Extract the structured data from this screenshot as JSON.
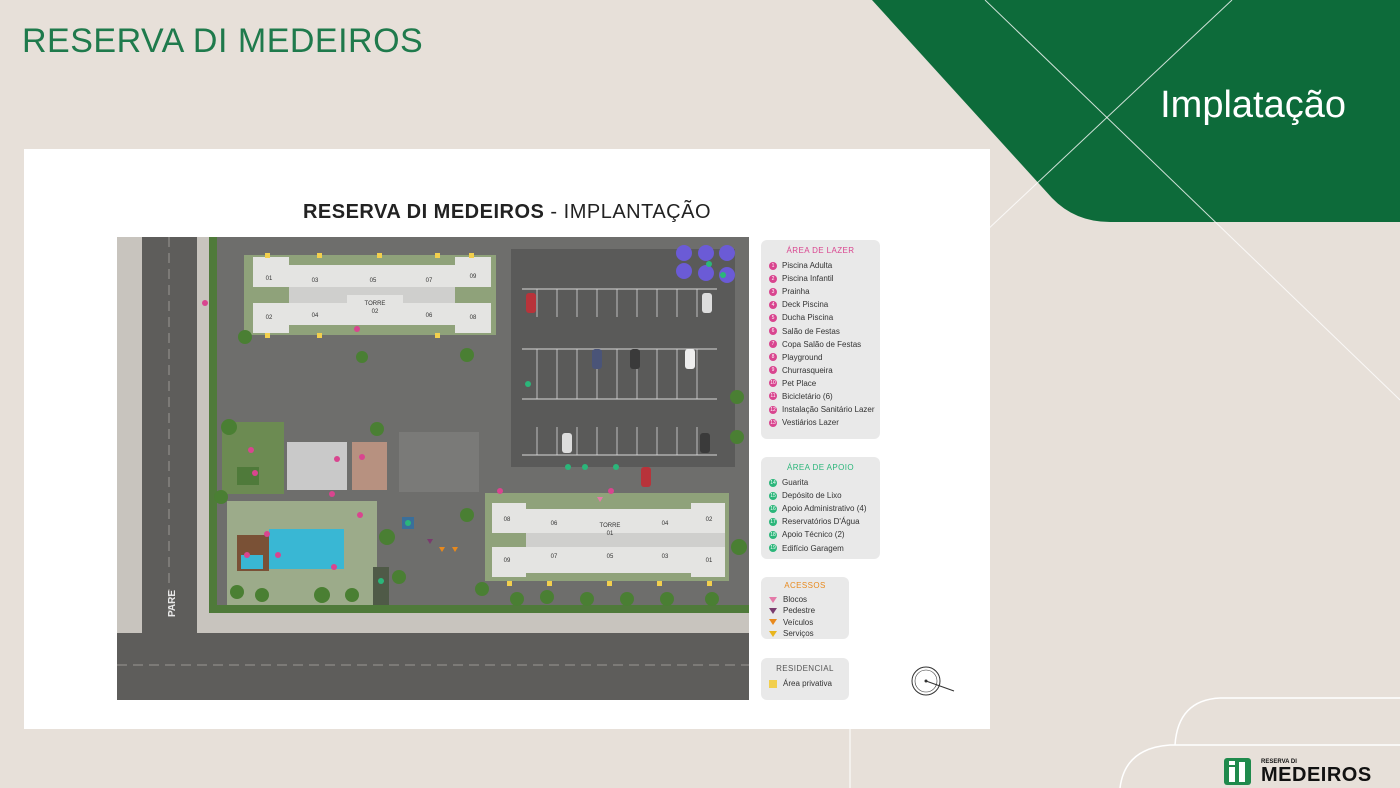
{
  "header": {
    "brand": "RESERVA DI MEDEIROS",
    "section": "Implatação"
  },
  "plan": {
    "title_bold": "RESERVA DI MEDEIROS",
    "title_rest": " - IMPLANTAÇÃO",
    "street_label": "PARE",
    "tower1": {
      "label": "TORRE",
      "number": "01",
      "units_top": [
        "08",
        "06",
        "04",
        "02"
      ],
      "units_bottom": [
        "09",
        "07",
        "05",
        "03",
        "01"
      ]
    },
    "tower2": {
      "label": "TORRE",
      "number": "02",
      "units_top": [
        "01",
        "03",
        "05",
        "07",
        "09"
      ],
      "units_bottom": [
        "02",
        "04",
        "06",
        "08"
      ]
    }
  },
  "legend": {
    "lazer": {
      "title": "ÁREA DE LAZER",
      "items": [
        {
          "n": "1",
          "label": "Piscina Adulta"
        },
        {
          "n": "2",
          "label": "Piscina Infantil"
        },
        {
          "n": "3",
          "label": "Prainha"
        },
        {
          "n": "4",
          "label": "Deck Piscina"
        },
        {
          "n": "5",
          "label": "Ducha Piscina"
        },
        {
          "n": "6",
          "label": "Salão de Festas"
        },
        {
          "n": "7",
          "label": "Copa Salão de Festas"
        },
        {
          "n": "8",
          "label": "Playground"
        },
        {
          "n": "9",
          "label": "Churrasqueira"
        },
        {
          "n": "10",
          "label": "Pet Place"
        },
        {
          "n": "11",
          "label": "Bicicletário (6)"
        },
        {
          "n": "12",
          "label": "Instalação Sanitário Lazer"
        },
        {
          "n": "13",
          "label": "Vestiários Lazer"
        }
      ]
    },
    "apoio": {
      "title": "ÁREA DE APOIO",
      "items": [
        {
          "n": "14",
          "label": "Guarita"
        },
        {
          "n": "15",
          "label": "Depósito de Lixo"
        },
        {
          "n": "16",
          "label": "Apoio Administrativo (4)"
        },
        {
          "n": "17",
          "label": "Reservatórios D'Água"
        },
        {
          "n": "18",
          "label": "Apoio Técnico (2)"
        },
        {
          "n": "19",
          "label": "Edifício Garagem"
        }
      ]
    },
    "acessos": {
      "title": "ACESSOS",
      "items": [
        {
          "label": "Blocos",
          "color": "#e47aa8"
        },
        {
          "label": "Pedestre",
          "color": "#7a3b6e"
        },
        {
          "label": "Veículos",
          "color": "#e8891d"
        },
        {
          "label": "Serviços",
          "color": "#e8b51d"
        }
      ]
    },
    "residencial": {
      "title": "RESIDENCIAL",
      "items": [
        {
          "label": "Área privativa"
        }
      ]
    }
  },
  "logo": {
    "small": "RESERVA DI",
    "big": "MEDEIROS"
  },
  "colors": {
    "brand_green": "#1f7a4c",
    "banner_green": "#0d6b3a",
    "background": "#e7e0d9",
    "lazer_pink": "#d9458f",
    "apoio_green": "#2bb67a"
  }
}
